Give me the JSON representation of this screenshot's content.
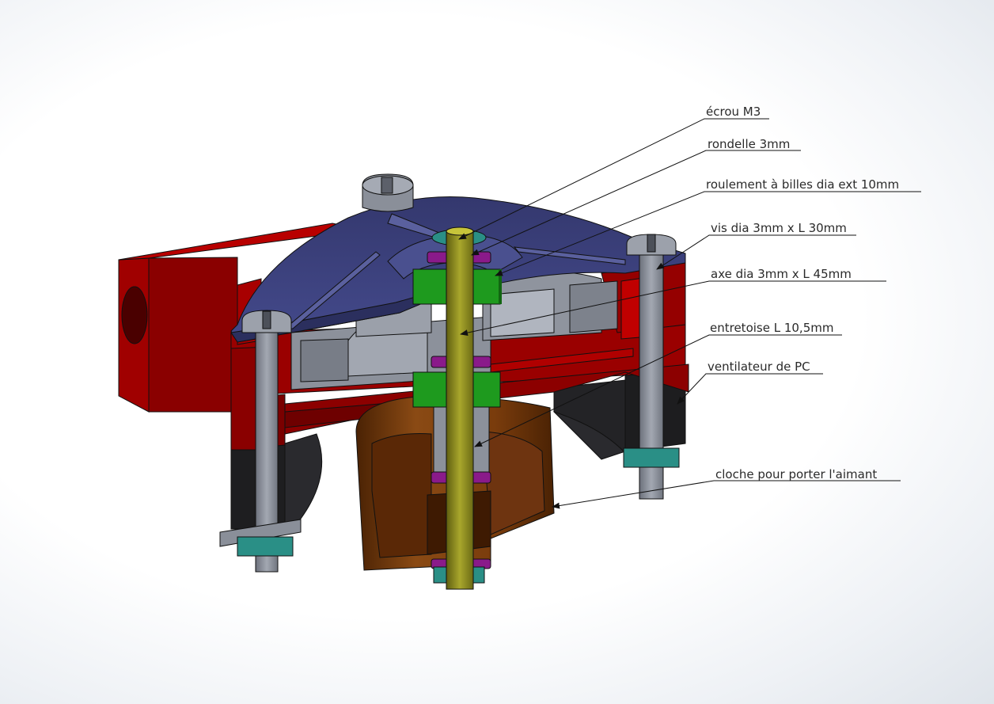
{
  "callouts": [
    {
      "id": "ecrou",
      "label": "écrou M3"
    },
    {
      "id": "rondelle",
      "label": "rondelle 3mm"
    },
    {
      "id": "roulement",
      "label": "roulement à billes dia ext 10mm"
    },
    {
      "id": "vis",
      "label": "vis dia 3mm x L 30mm"
    },
    {
      "id": "axe",
      "label": "axe dia 3mm x L 45mm"
    },
    {
      "id": "entretoise",
      "label": "entretoise L 10,5mm"
    },
    {
      "id": "ventilateur",
      "label": "ventilateur de PC"
    },
    {
      "id": "cloche",
      "label": "cloche pour porter l'aimant"
    }
  ],
  "colors": {
    "red_body": "#8f0000",
    "red_bright": "#c00000",
    "blue_plate": "#3b3f7a",
    "grey_part": "#8a8f99",
    "fan_black": "#1d1d1f",
    "shaft": "#8c8a1e",
    "bearing_green": "#1a8c1a",
    "washer_purple": "#8a1a8a",
    "nut_teal": "#2a8f86",
    "bell_brown": "#6a3208"
  }
}
